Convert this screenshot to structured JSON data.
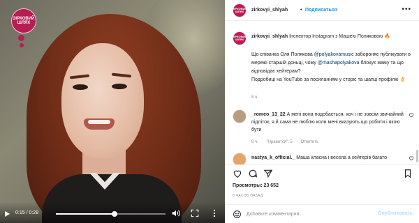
{
  "video": {
    "logo_text": [
      "ЗІРКОВИЙ",
      "ШЛЯХ"
    ],
    "time": "0:15 / 0:28",
    "progress": 0.536
  },
  "header": {
    "avatar_text": "ЗІРКОВИЙ ШЛЯХ",
    "username": "zirkovyi_shlyah",
    "dot": "•",
    "follow_label": "Подписаться",
    "more_label": "•••"
  },
  "caption": {
    "avatar_text": "ЗІРКОВИЙ ШЛЯХ",
    "username": "zirkovyi_shlyah",
    "title": "Інспектор Instagram з Машею Поляковою 🔥",
    "body_1": "Що співачка Оля Полякова ",
    "mention_1": "@polyakovamusic",
    "body_2": " забороняє публікувати в мережі старшій доньці, чому ",
    "mention_2": "@mashapolyakova",
    "body_3": " блокує маму та що відповідає хейтерам?",
    "more": "Подробиці на YouTube за посиланням у сторіс та шапці профілю 👌",
    "age": "8 ч."
  },
  "comments": [
    {
      "username": "_romeo_13_22",
      "text": "А мені вона подобається, хоч і не зовсім звичайний підліток, я й сама не люблю коли мені вказують що робити і якою бути",
      "age": "8 ч.",
      "likes": "\"Нравится\": 5",
      "reply": "Ответить"
    },
    {
      "username": "nastya_k_official._",
      "text": "Маша класна і весела а хейтерів багато"
    }
  ],
  "stats": {
    "views_label": "Просмотры:",
    "views_value": "23 652",
    "ago": "8 ЧАСОВ НАЗАД"
  },
  "add_comment": {
    "placeholder": "Добавьте комментарий...",
    "publish_label": "Опубликовать"
  }
}
